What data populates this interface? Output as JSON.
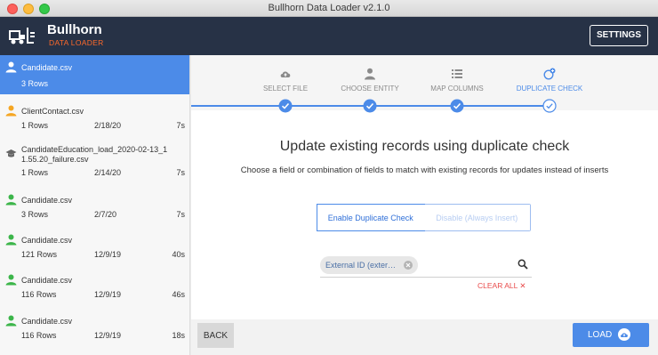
{
  "window": {
    "title": "Bullhorn Data Loader v2.1.0"
  },
  "header": {
    "brand_name": "Bullhorn",
    "brand_sub": "DATA LOADER",
    "settings_label": "SETTINGS"
  },
  "sidebar": {
    "items": [
      {
        "name": "Candidate.csv",
        "rows": "3 Rows",
        "date": "",
        "duration": "",
        "icon": "person-icon",
        "icon_color": "#ffffff",
        "active": true
      },
      {
        "name": "ClientContact.csv",
        "rows": "1 Rows",
        "date": "2/18/20",
        "duration": "7s",
        "icon": "person-icon",
        "icon_color": "#f5a623"
      },
      {
        "name": "CandidateEducation_load_2020-02-13_11.55.20_failure.csv",
        "name_line1": "CandidateEducation_load_2020-02-13_1",
        "name_line2": "1.55.20_failure.csv",
        "rows": "1 Rows",
        "date": "2/14/20",
        "duration": "7s",
        "icon": "graduation-cap-icon",
        "icon_color": "#666666"
      },
      {
        "name": "Candidate.csv",
        "rows": "3 Rows",
        "date": "2/7/20",
        "duration": "7s",
        "icon": "person-icon",
        "icon_color": "#3cb54a"
      },
      {
        "name": "Candidate.csv",
        "rows": "121 Rows",
        "date": "12/9/19",
        "duration": "40s",
        "icon": "person-icon",
        "icon_color": "#3cb54a"
      },
      {
        "name": "Candidate.csv",
        "rows": "116 Rows",
        "date": "12/9/19",
        "duration": "46s",
        "icon": "person-icon",
        "icon_color": "#3cb54a"
      },
      {
        "name": "Candidate.csv",
        "rows": "116 Rows",
        "date": "12/9/19",
        "duration": "18s",
        "icon": "person-icon",
        "icon_color": "#3cb54a"
      }
    ]
  },
  "stepper": {
    "steps": [
      {
        "label": "SELECT FILE",
        "icon": "cloud-upload-icon",
        "done": true
      },
      {
        "label": "CHOOSE ENTITY",
        "icon": "person-icon",
        "done": true
      },
      {
        "label": "MAP COLUMNS",
        "icon": "list-icon",
        "done": true
      },
      {
        "label": "DUPLICATE CHECK",
        "icon": "duplicate-check-icon",
        "current": true
      }
    ]
  },
  "main": {
    "heading": "Update existing records using duplicate check",
    "subheading": "Choose a field or combination of fields to match with existing records for updates instead of inserts",
    "toggle": {
      "enable_label": "Enable Duplicate Check",
      "disable_label": "Disable (Always Insert)",
      "selected": "enable"
    },
    "field_chip": "External ID (exter…",
    "clear_all": "CLEAR ALL"
  },
  "footer": {
    "back_label": "BACK",
    "load_label": "LOAD"
  },
  "colors": {
    "accent": "#4c8be8",
    "header_bg": "#273246",
    "brand_orange": "#ff6a2b",
    "danger": "#e94b4b"
  }
}
